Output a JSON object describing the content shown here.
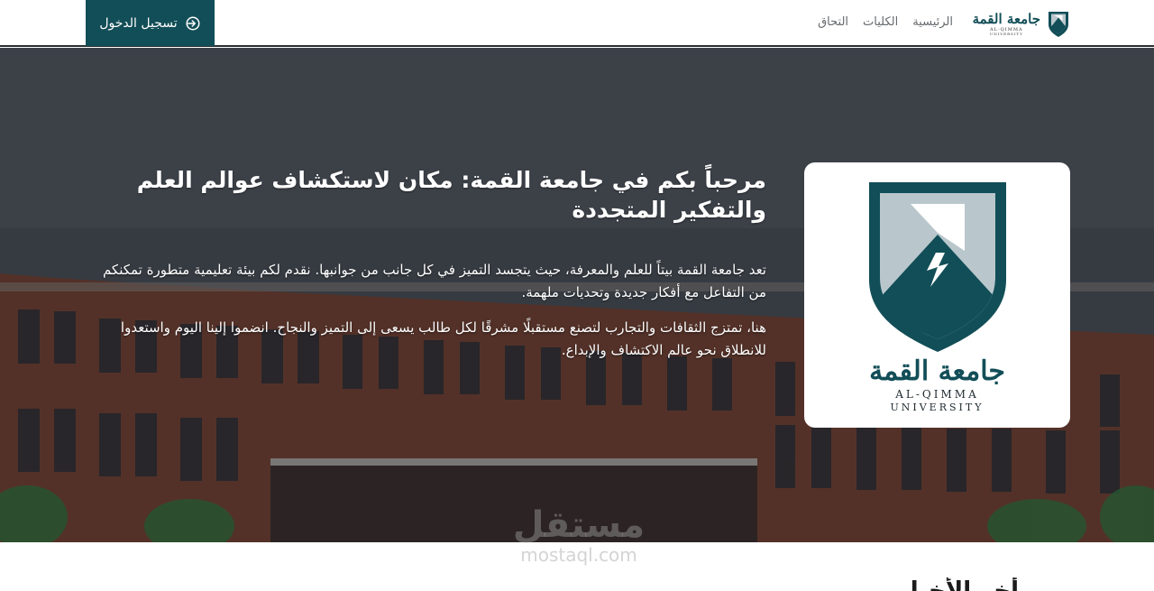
{
  "navbar": {
    "login_label": "تسجيل الدخول",
    "links": [
      "الرئيسية",
      "الكليات",
      "التحاق"
    ],
    "brand": {
      "arabic_name": "جامعة القمة",
      "english_line1": "AL-QIMMA",
      "english_line2": "UNIVERSITY"
    }
  },
  "hero": {
    "title": "مرحباً بكم في جامعة القمة: مكان لاستكشاف عوالم العلم والتفكير المتجددة",
    "paragraph1": "تعد جامعة القمة بيتاً للعلم والمعرفة، حيث يتجسد التميز في كل جانب من جوانبها. نقدم لكم بيئة تعليمية متطورة تمكنكم من التفاعل مع أفكار جديدة وتحديات ملهمة.",
    "paragraph2": "هنا، تمتزج الثقافات والتجارب لتصنع مستقبلًا مشرقًا لكل طالب يسعى إلى التميز والنجاح. انضموا إلينا اليوم واستعدوا للانطلاق نحو عالم الاكتشاف والإبداع.",
    "logo_card": {
      "arabic_name": "جامعة القمة",
      "english_line1": "AL-QIMMA",
      "english_line2": "UNIVERSITY"
    }
  },
  "watermark": {
    "arabic": "مستقل",
    "latin": "mostaql.com"
  },
  "section": {
    "heading": "أخر الأخبار"
  },
  "colors": {
    "brand_teal": "#124e57",
    "shield_light": "#b9c7cc",
    "nav_text": "#666a6e"
  },
  "icons": {
    "login": "login-arrow-icon",
    "brand": "shield-mountain-icon"
  }
}
